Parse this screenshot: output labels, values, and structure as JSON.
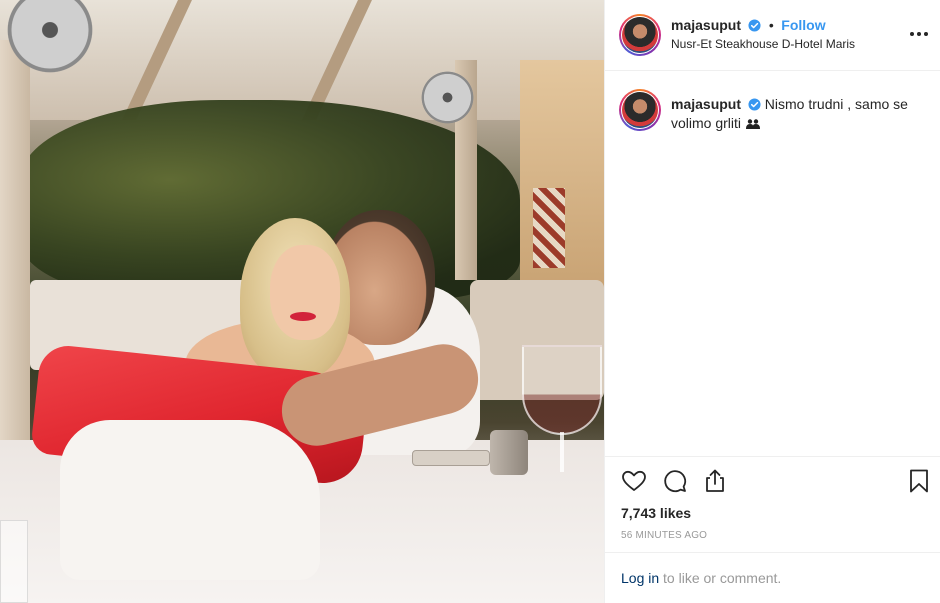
{
  "post": {
    "username": "majasuput",
    "follow_label": "Follow",
    "dot": "•",
    "location": "Nusr-Et Steakhouse D-Hotel Maris",
    "caption_username": "majasuput",
    "caption_text": "Nismo trudni , samo se volimo grliti",
    "caption_emoji": "couple-silhouette-emoji",
    "likes": "7,743 likes",
    "time": "56 MINUTES AGO",
    "login_link": "Log in",
    "login_rest": " to like or comment."
  },
  "icons": {
    "verified": "verified-badge-icon",
    "more": "more-options-icon",
    "like": "heart-icon",
    "comment": "comment-bubble-icon",
    "share": "share-icon",
    "save": "bookmark-icon"
  },
  "colors": {
    "link_blue": "#3897f0",
    "login_link": "#003569",
    "muted": "#999999",
    "text": "#262626",
    "divider": "#efefef"
  }
}
